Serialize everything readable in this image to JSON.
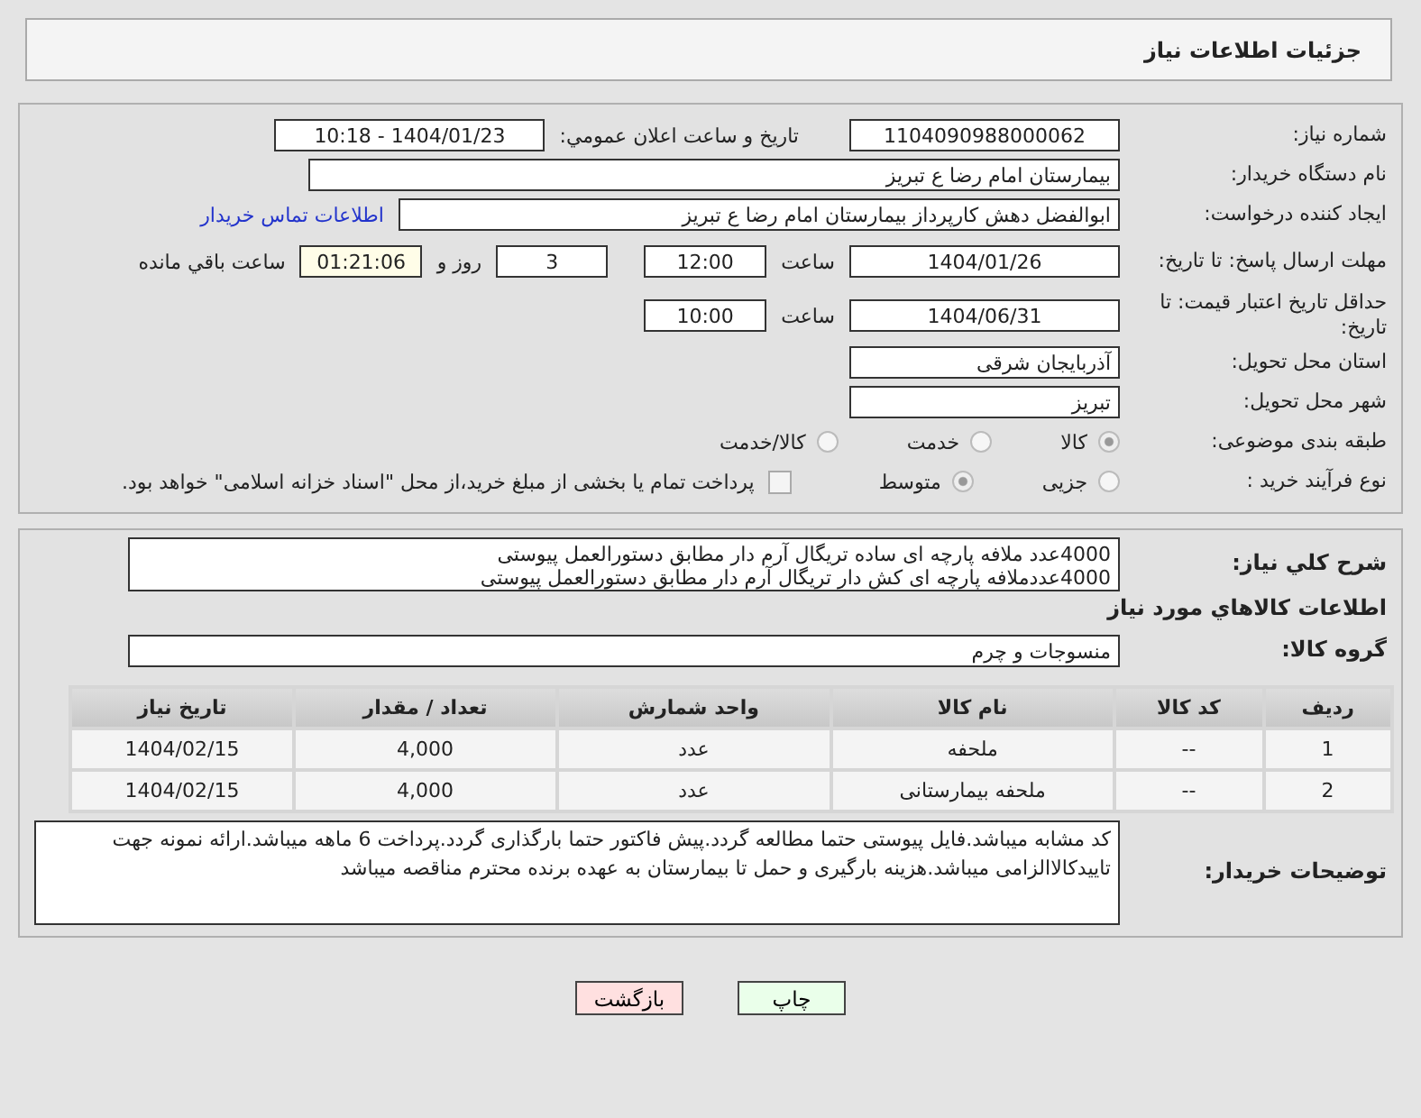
{
  "header": {
    "title": "جزئیات اطلاعات نیاز"
  },
  "need_number": {
    "label": "شماره نیاز:",
    "value": "1104090988000062"
  },
  "announce": {
    "label": "تاریخ و ساعت اعلان عمومي:",
    "value": "1404/01/23 - 10:18"
  },
  "buyer_org": {
    "label": "نام دستگاه خریدار:",
    "value": "بیمارستان امام رضا  ع  تبریز"
  },
  "requester": {
    "label": "ایجاد کننده درخواست:",
    "value": "ابوالفضل دهش کارپرداز بیمارستان امام رضا  ع  تبریز",
    "link": "اطلاعات تماس خریدار"
  },
  "reply_deadline": {
    "label": "مهلت ارسال پاسخ: تا تاریخ:",
    "date": "1404/01/26",
    "time_label": "ساعت",
    "time": "12:00",
    "days": "3",
    "days_label": "روز و",
    "remaining": "01:21:06",
    "remaining_label": "ساعت باقي مانده"
  },
  "price_validity": {
    "label": "حداقل تاریخ اعتبار قیمت: تا تاریخ:",
    "date": "1404/06/31",
    "time_label": "ساعت",
    "time": "10:00"
  },
  "province": {
    "label": "استان محل تحویل:",
    "value": "آذربایجان شرقی"
  },
  "city": {
    "label": "شهر محل تحویل:",
    "value": "تبریز"
  },
  "category": {
    "label": "طبقه بندی موضوعی:",
    "options": [
      {
        "label": "کالا",
        "selected": true
      },
      {
        "label": "خدمت",
        "selected": false
      },
      {
        "label": "کالا/خدمت",
        "selected": false
      }
    ]
  },
  "purchase_type": {
    "label": "نوع فرآیند خرید :",
    "options": [
      {
        "label": "جزیی",
        "selected": false
      },
      {
        "label": "متوسط",
        "selected": true
      }
    ],
    "treasury": {
      "checked": false,
      "text": "پرداخت تمام یا بخشی از مبلغ خرید،از محل \"اسناد خزانه اسلامی\" خواهد بود."
    }
  },
  "description": {
    "label": "شرح كلي نياز:",
    "lines": [
      "4000عدد ملافه پارچه ای ساده تریگال آرم دار مطابق دستورالعمل پیوستی",
      "4000عددملافه پارچه ای کش دار تریگال آرم دار مطابق دستورالعمل پیوستی"
    ]
  },
  "goods_heading": "اطلاعات كالاهاي مورد نياز",
  "goods_group": {
    "label": "گروه کالا:",
    "value": "منسوجات و چرم"
  },
  "table": {
    "columns": [
      "ردیف",
      "کد کالا",
      "نام کالا",
      "واحد شمارش",
      "تعداد / مقدار",
      "تاریخ نیاز"
    ],
    "rows": [
      [
        "1",
        "--",
        "ملحفه",
        "عدد",
        "4,000",
        "1404/02/15"
      ],
      [
        "2",
        "--",
        "ملحفه بیمارستانی",
        "عدد",
        "4,000",
        "1404/02/15"
      ]
    ]
  },
  "buyer_notes": {
    "label": "توضیحات خریدار:",
    "value": "کد مشابه میباشد.فایل پیوستی حتما مطالعه گردد.پیش فاکتور حتما بارگذاری گردد.پرداخت 6 ماهه میباشد.ارائه نمونه جهت تاییدکالاالزامی میباشد.هزینه بارگیری و حمل تا بیمارستان به عهده برنده محترم مناقصه میباشد"
  },
  "buttons": [
    {
      "label": "چاپ",
      "kind": "print"
    },
    {
      "label": "بازگشت",
      "kind": "back"
    }
  ]
}
